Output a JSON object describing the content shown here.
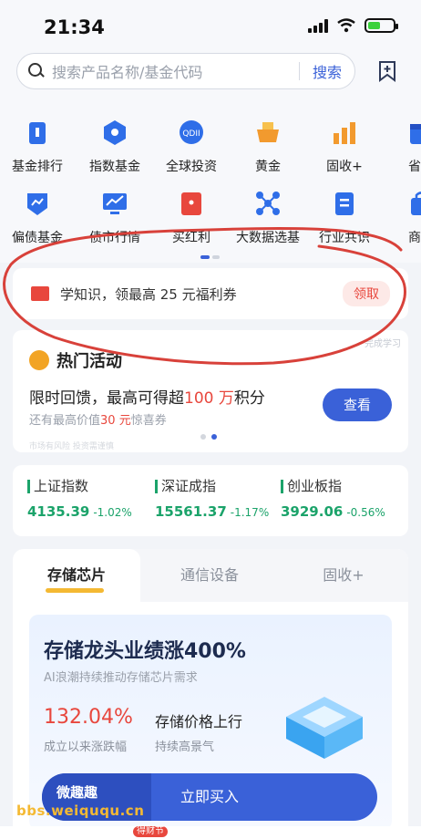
{
  "status": {
    "time": "21:34"
  },
  "search": {
    "placeholder": "搜索产品名称/基金代码",
    "button": "搜索"
  },
  "menu": {
    "row1": [
      {
        "label": "基金排行",
        "icon": "ranking-icon",
        "color": "#2f6ee8"
      },
      {
        "label": "指数基金",
        "icon": "index-fund-icon",
        "color": "#2f6ee8"
      },
      {
        "label": "全球投资",
        "icon": "qdii-icon",
        "color": "#2f6ee8"
      },
      {
        "label": "黄金",
        "icon": "gold-icon",
        "color": "#f29a2e"
      },
      {
        "label": "固收+",
        "icon": "fixed-income-icon",
        "color": "#f29a2e"
      },
      {
        "label": "省心",
        "icon": "calendar-icon",
        "color": "#2f6ee8"
      }
    ],
    "row2": [
      {
        "label": "偏债基金",
        "icon": "bond-fund-icon",
        "color": "#2f6ee8"
      },
      {
        "label": "债市行情",
        "icon": "bond-market-icon",
        "color": "#2f6ee8"
      },
      {
        "label": "买红利",
        "icon": "dividend-icon",
        "color": "#e8473d"
      },
      {
        "label": "大数据选基",
        "icon": "big-data-icon",
        "color": "#2f6ee8"
      },
      {
        "label": "行业共识",
        "icon": "industry-icon",
        "color": "#2f6ee8"
      },
      {
        "label": "商品",
        "icon": "bag-icon",
        "color": "#2f6ee8"
      }
    ]
  },
  "promo": {
    "text": "学知识，领最高 25 元福利券",
    "action": "领取"
  },
  "activity": {
    "title": "热门活动",
    "hint": "完成学习",
    "line1_pre": "限时回馈，最高可得超",
    "line1_hl": "100 万",
    "line1_post": "积分",
    "line2_pre": "还有最高价值",
    "line2_hl": "30 元",
    "line2_post": "惊喜券",
    "button": "查看",
    "fine": "市场有风险 投资需谨慎"
  },
  "indices": [
    {
      "name": "上证指数",
      "value": "4135.39",
      "change": "-1.02%"
    },
    {
      "name": "深证成指",
      "value": "15561.37",
      "change": "-1.17%"
    },
    {
      "name": "创业板指",
      "value": "3929.06",
      "change": "-0.56%"
    }
  ],
  "theme": {
    "tabs": [
      "存储芯片",
      "通信设备",
      "固收+"
    ],
    "fund_title": "存储龙头业绩涨400%",
    "fund_sub": "AI浪潮持续推动存储芯片需求",
    "rate": "132.04%",
    "rate_label": "成立以来涨跌幅",
    "feature": "存储价格上行",
    "feature_sub": "持续高景气"
  },
  "buy": {
    "label": "立即买入"
  },
  "watermark": {
    "line1": "微趣趣",
    "line2": "bbs.weiququ.cn"
  },
  "nav": {
    "tag": "得财节"
  },
  "colors": {
    "accent": "#3a61d8",
    "down": "#1ba36a",
    "red": "#e8473d",
    "gold": "#f4b933"
  }
}
